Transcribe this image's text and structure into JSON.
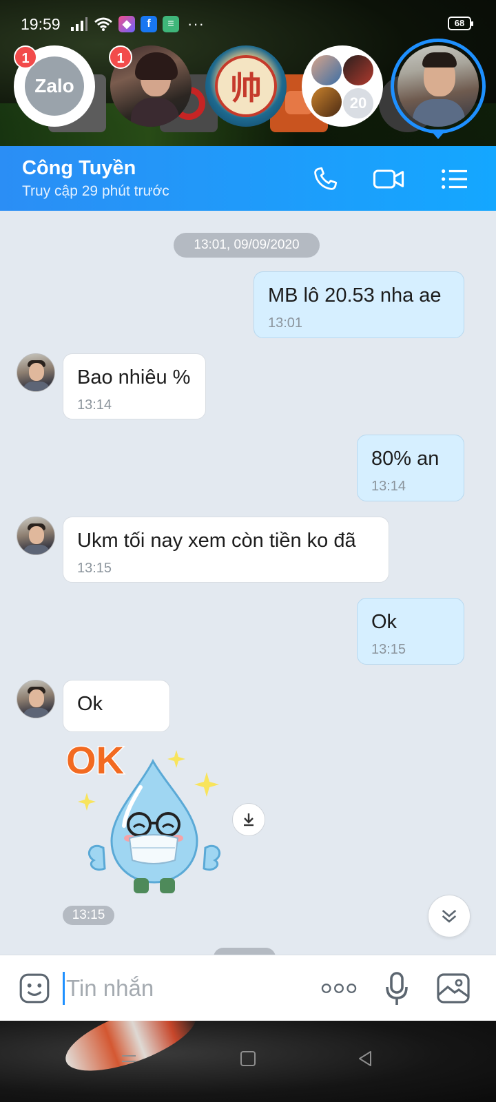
{
  "status_bar": {
    "time": "19:59",
    "battery": "68",
    "more": "···"
  },
  "chat_heads": {
    "zalo": {
      "label": "Zalo",
      "badge": "1"
    },
    "contact_photo": {
      "badge": "1"
    },
    "game": {
      "glyph": "帅"
    },
    "group": {
      "count": "20"
    }
  },
  "header": {
    "name": "Công Tuyền",
    "status": "Truy cập 29 phút trước"
  },
  "chat": {
    "date_separator": "13:01, 09/09/2020",
    "messages": [
      {
        "from": "me",
        "text": "MB lô 20.53 nha ae",
        "time": "13:01"
      },
      {
        "from": "them",
        "text": "Bao nhiêu %",
        "time": "13:14"
      },
      {
        "from": "me",
        "text": "80% an",
        "time": "13:14"
      },
      {
        "from": "them",
        "text": "Ukm tối nay xem còn tiền ko đã",
        "time": "13:15"
      },
      {
        "from": "me",
        "text": "Ok",
        "time": "13:15"
      },
      {
        "from": "them",
        "text": "Ok"
      }
    ],
    "sticker": {
      "text": "OK",
      "time": "13:15"
    }
  },
  "input": {
    "placeholder": "Tin nhắn"
  },
  "colors": {
    "header_start": "#2b8ef5",
    "header_end": "#14a7ff",
    "my_bubble": "#d6efff",
    "their_bubble": "#ffffff",
    "chat_bg": "#e3e9f0",
    "badge": "#f24b4b"
  }
}
